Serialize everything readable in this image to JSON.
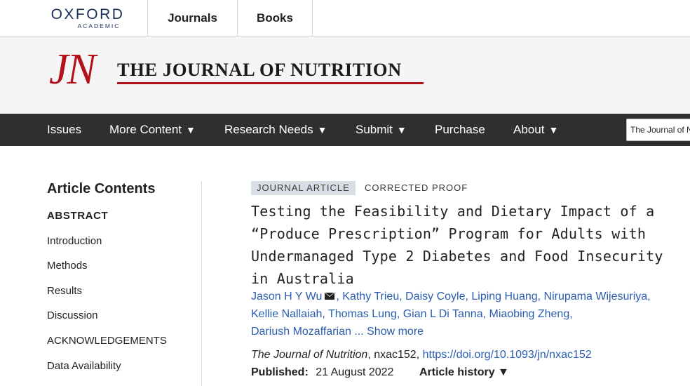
{
  "header": {
    "logo_line1": "OXFORD",
    "logo_line2": "ACADEMIC",
    "nav": [
      "Journals",
      "Books"
    ]
  },
  "journal": {
    "mark": "JN",
    "title": "THE JOURNAL OF NUTRITION",
    "brand_color": "#b3121a"
  },
  "main_nav": {
    "items": [
      {
        "label": "Issues",
        "dropdown": false
      },
      {
        "label": "More Content",
        "dropdown": true
      },
      {
        "label": "Research Needs",
        "dropdown": true
      },
      {
        "label": "Submit",
        "dropdown": true
      },
      {
        "label": "Purchase",
        "dropdown": false
      },
      {
        "label": "About",
        "dropdown": true
      }
    ],
    "dropdown_glyph": "▼",
    "search_scope": "The Journal of N"
  },
  "sidebar": {
    "title": "Article Contents",
    "items": [
      "ABSTRACT",
      "Introduction",
      "Methods",
      "Results",
      "Discussion",
      "ACKNOWLEDGEMENTS",
      "Data Availability"
    ]
  },
  "article": {
    "type_tag": "JOURNAL ARTICLE",
    "status_tag": "CORRECTED PROOF",
    "title_lines": [
      "Testing the Feasibility and Dietary Impact of a",
      "“Produce Prescription” Program for Adults with",
      "Undermanaged Type 2 Diabetes and Food Insecurity",
      "in Australia"
    ],
    "authors": [
      "Jason H Y Wu",
      "Kathy Trieu",
      "Daisy Coyle",
      "Liping Huang",
      "Nirupama Wijesuriya",
      "Kellie Nallaiah",
      "Thomas Lung",
      "Gian L Di Tanna",
      "Miaobing Zheng",
      "Dariush Mozaffarian"
    ],
    "authors_more": "... Show more",
    "journal_name": "The Journal of Nutrition",
    "article_id": ", nxac152, ",
    "doi": "https://doi.org/10.1093/jn/nxac152",
    "published_label": "Published:",
    "published_date": "21 August 2022",
    "history_label": "Article history ▼",
    "link_color": "#2a5db0"
  }
}
